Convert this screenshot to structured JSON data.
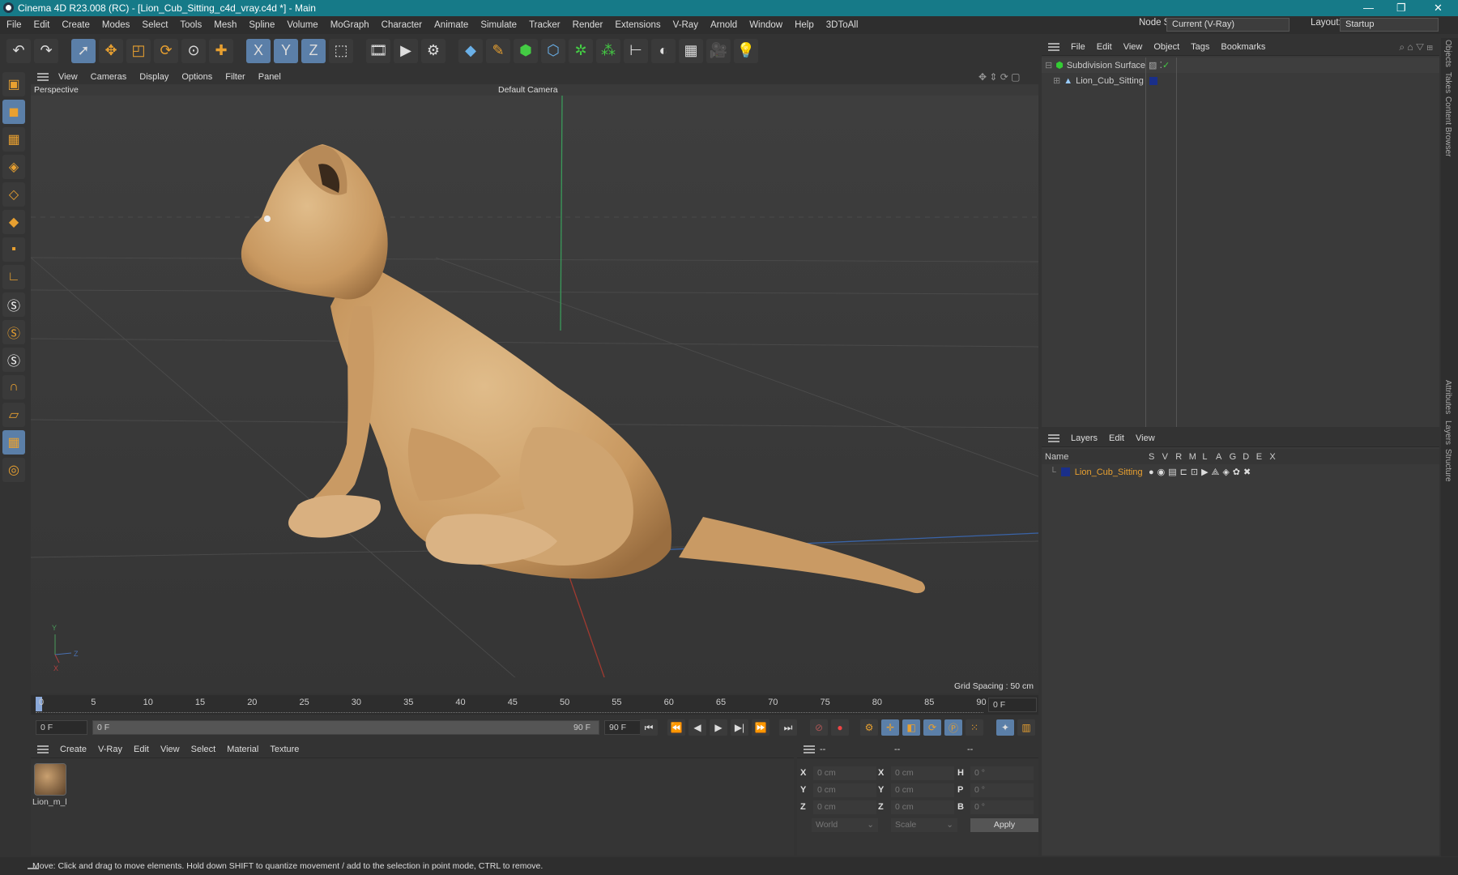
{
  "window": {
    "title": "Cinema 4D R23.008 (RC) - [Lion_Cub_Sitting_c4d_vray.c4d *] - Main",
    "controls": [
      "—",
      "❐",
      "✕"
    ]
  },
  "menubar": {
    "items": [
      "File",
      "Edit",
      "Create",
      "Modes",
      "Select",
      "Tools",
      "Mesh",
      "Spline",
      "Volume",
      "MoGraph",
      "Character",
      "Animate",
      "Simulate",
      "Tracker",
      "Render",
      "Extensions",
      "V-Ray",
      "Arnold",
      "Window",
      "Help",
      "3DToAll"
    ],
    "node_space_label": "Node Space:",
    "node_space_value": "Current (V-Ray)",
    "layout_label": "Layout:",
    "layout_value": "Startup"
  },
  "toolbar": {
    "icons": [
      "undo-icon",
      "redo-icon",
      "select-icon",
      "move-icon",
      "scale-icon",
      "rotate-icon",
      "recent-tool-icon",
      "add-icon",
      "x-axis-icon",
      "y-axis-icon",
      "z-axis-icon",
      "coord-system-icon",
      "render-region-icon",
      "render-view-icon",
      "render-settings-icon",
      "cube-icon",
      "pen-icon",
      "subdivision-icon",
      "extrude-icon",
      "cloner-icon",
      "mograph-icon",
      "deformer-icon",
      "field-icon",
      "floor-icon",
      "camera-icon",
      "light-icon"
    ],
    "axis_labels": [
      "X",
      "Y",
      "Z"
    ]
  },
  "viewport": {
    "menu": [
      "View",
      "Cameras",
      "Display",
      "Options",
      "Filter",
      "Panel"
    ],
    "view_name": "Perspective",
    "camera": "Default Camera",
    "grid_spacing": "Grid Spacing : 50 cm",
    "axis": {
      "y": "Y",
      "z": "Z",
      "x": "X"
    }
  },
  "timeline": {
    "ticks": [
      "0",
      "5",
      "10",
      "15",
      "20",
      "25",
      "30",
      "35",
      "40",
      "45",
      "50",
      "55",
      "60",
      "65",
      "70",
      "75",
      "80",
      "85",
      "90"
    ],
    "current_frame": "0 F",
    "start": "0 F",
    "range_start": "0 F",
    "range_end": "90 F",
    "end": "90 F"
  },
  "materials": {
    "menu": [
      "Create",
      "V-Ray",
      "Edit",
      "View",
      "Select",
      "Material",
      "Texture"
    ],
    "items": [
      {
        "name": "Lion_m_l"
      }
    ]
  },
  "coords": {
    "headers": [
      "--",
      "--",
      "--"
    ],
    "rows": [
      {
        "l1": "X",
        "v1": "0 cm",
        "l2": "X",
        "v2": "0 cm",
        "l3": "H",
        "v3": "0 °"
      },
      {
        "l1": "Y",
        "v1": "0 cm",
        "l2": "Y",
        "v2": "0 cm",
        "l3": "P",
        "v3": "0 °"
      },
      {
        "l1": "Z",
        "v1": "0 cm",
        "l2": "Z",
        "v2": "0 cm",
        "l3": "B",
        "v3": "0 °"
      }
    ],
    "mode": "World",
    "transform": "Scale",
    "apply": "Apply"
  },
  "objects": {
    "menu": [
      "File",
      "Edit",
      "View",
      "Object",
      "Tags",
      "Bookmarks"
    ],
    "items": [
      {
        "name": "Subdivision Surface"
      },
      {
        "name": "Lion_Cub_Sitting"
      }
    ]
  },
  "layers": {
    "menu": [
      "Layers",
      "Edit",
      "View"
    ],
    "columns": [
      "Name",
      "S",
      "V",
      "R",
      "M",
      "L",
      "A",
      "G",
      "D",
      "E",
      "X"
    ],
    "items": [
      {
        "name": "Lion_Cub_Sitting",
        "color": "#1a2f8a"
      }
    ]
  },
  "right_tabs": [
    "Objects",
    "Takes",
    "Content Browser",
    "Attributes",
    "Layers",
    "Structure"
  ],
  "status": "Move: Click and drag to move elements. Hold down SHIFT to quantize movement / add to the selection in point mode, CTRL to remove."
}
